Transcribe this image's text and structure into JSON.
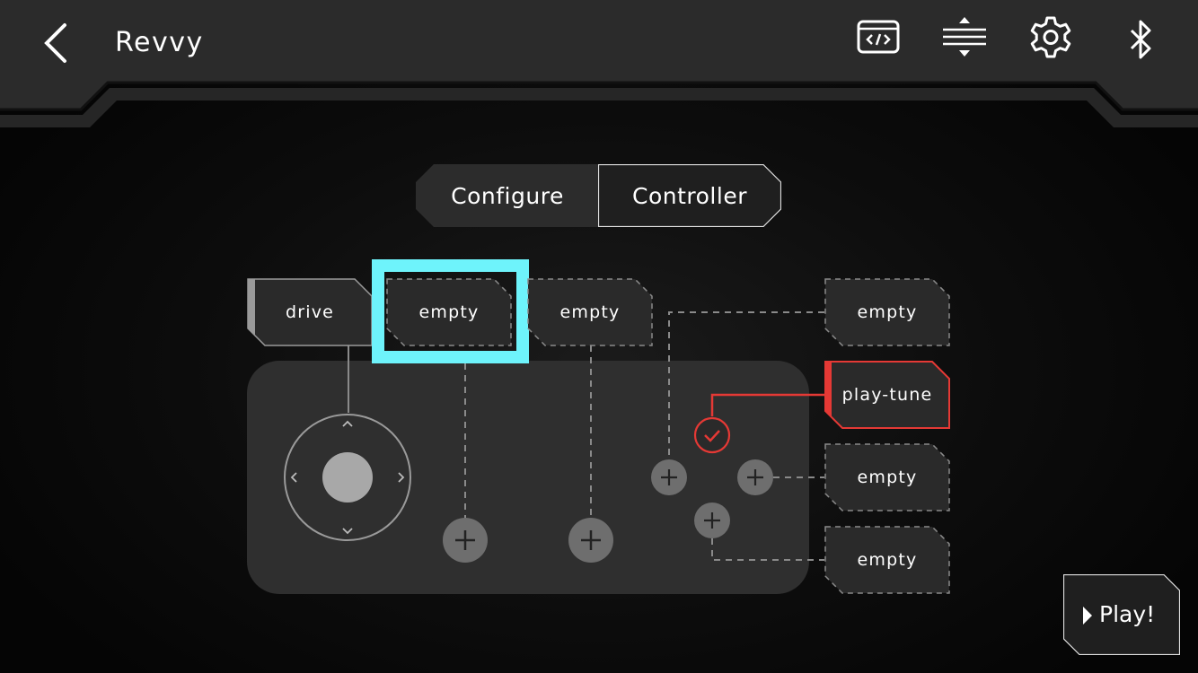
{
  "header": {
    "title": "Revvy"
  },
  "tabs": [
    {
      "label": "Configure",
      "active": false
    },
    {
      "label": "Controller",
      "active": true
    }
  ],
  "slots": {
    "top_left": "drive",
    "top_selected": "empty",
    "top_third": "empty",
    "right_1": "empty",
    "right_2": "play-tune",
    "right_3": "empty",
    "right_4": "empty"
  },
  "play_button": {
    "label": "Play!"
  },
  "colors": {
    "selection": "#6ef3fb",
    "assigned": "#e53935",
    "slot_bg": "#2a2a2a",
    "pad_bg": "#2f2f2f",
    "add_button": "#6e6e6e"
  },
  "icons": [
    "back-arrow-icon",
    "code-icon",
    "arrows-updown-icon",
    "gear-icon",
    "bluetooth-icon",
    "plus-icon",
    "check-icon",
    "play-triangle-icon"
  ]
}
